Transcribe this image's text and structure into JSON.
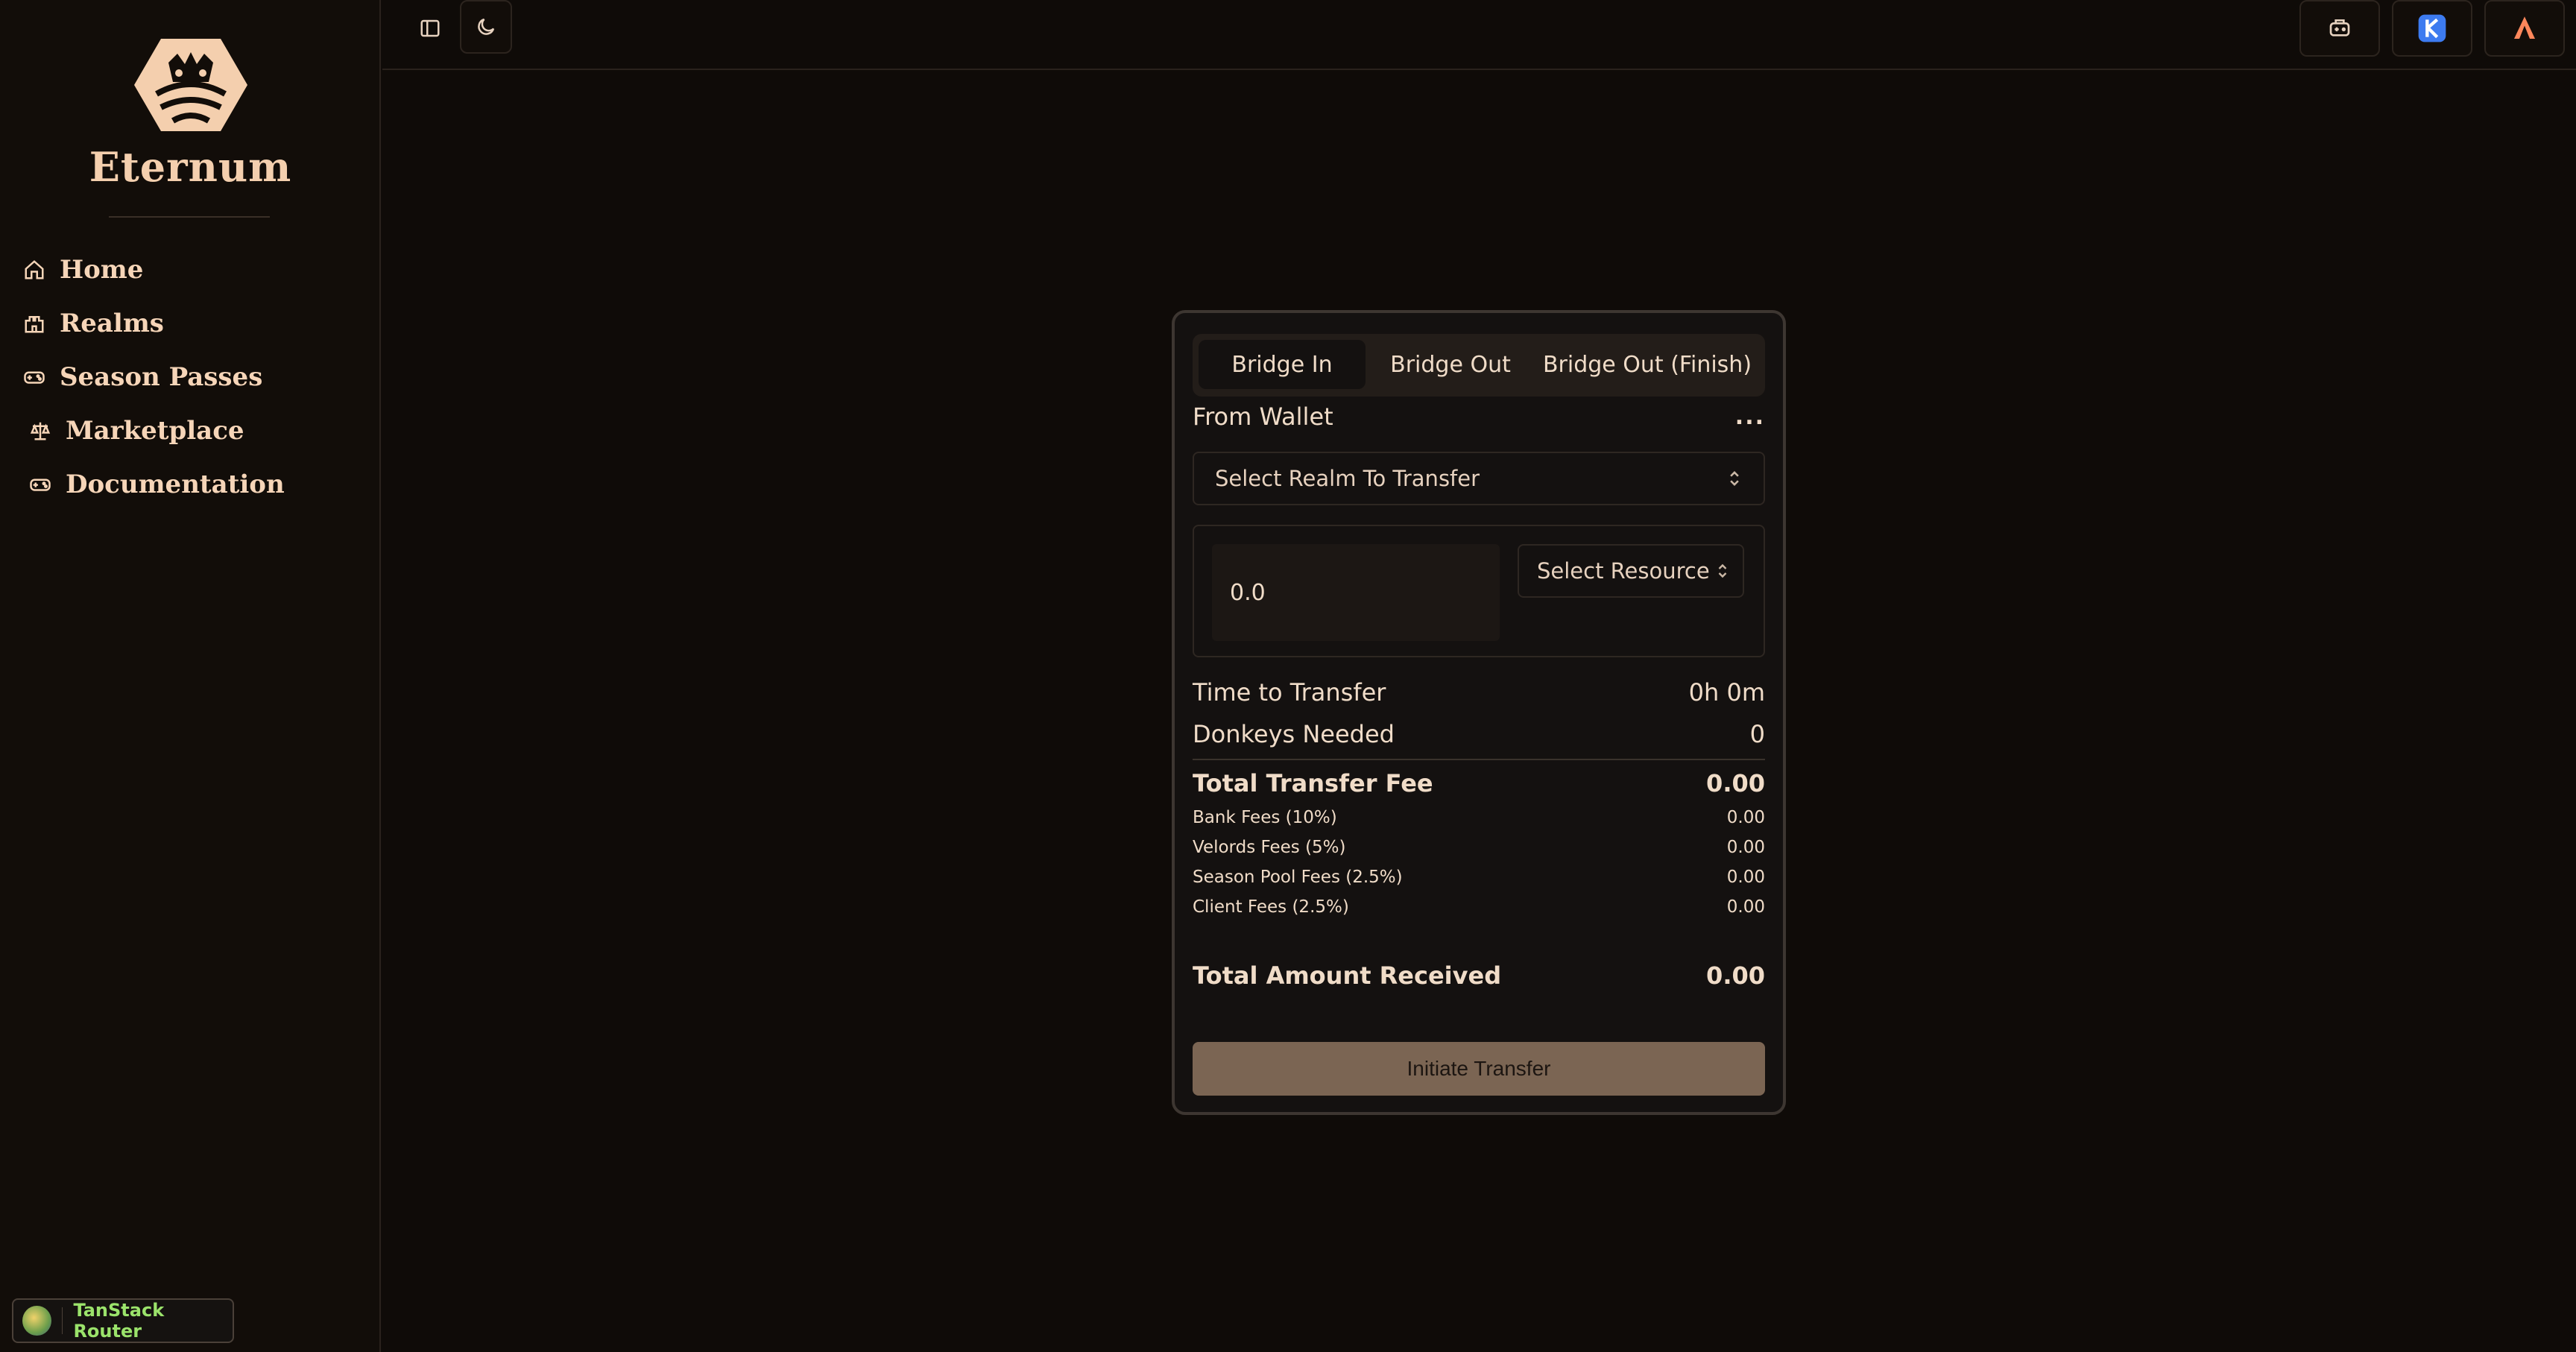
{
  "brand": {
    "name": "Eternum"
  },
  "sidebar": {
    "items": [
      {
        "label": "Home",
        "icon": "home-icon"
      },
      {
        "label": "Realms",
        "icon": "castle-icon"
      },
      {
        "label": "Season Passes",
        "icon": "gamepad-icon"
      },
      {
        "label": "Marketplace",
        "icon": "scale-icon"
      },
      {
        "label": "Documentation",
        "icon": "gamepad-icon"
      }
    ]
  },
  "devtools": {
    "label": "TanStack Router"
  },
  "topbar": {
    "left": [
      "sidebar-toggle-icon",
      "moon-icon"
    ],
    "right": [
      "controller-icon",
      "k-wallet-icon",
      "argent-icon"
    ]
  },
  "bridge": {
    "tabs": [
      {
        "label": "Bridge In",
        "active": true
      },
      {
        "label": "Bridge Out",
        "active": false
      },
      {
        "label": "Bridge Out (Finish)",
        "active": false
      }
    ],
    "from_label": "From Wallet",
    "from_value": "...",
    "realm_select": "Select Realm To Transfer",
    "amount_value": "0.0",
    "resource_select": "Select Resource",
    "time_label": "Time to Transfer",
    "time_value": "0h 0m",
    "donkeys_label": "Donkeys Needed",
    "donkeys_value": "0",
    "total_fee_label": "Total Transfer Fee",
    "total_fee_value": "0.00",
    "fees": [
      {
        "label": "Bank Fees (10%)",
        "value": "0.00"
      },
      {
        "label": "Velords Fees (5%)",
        "value": "0.00"
      },
      {
        "label": "Season Pool Fees (2.5%)",
        "value": "0.00"
      },
      {
        "label": "Client Fees (2.5%)",
        "value": "0.00"
      }
    ],
    "received_label": "Total Amount Received",
    "received_value": "0.00",
    "submit_label": "Initiate Transfer"
  },
  "colors": {
    "background": "#0f0b08",
    "accent": "#f4cfae",
    "button": "#7b6553"
  }
}
